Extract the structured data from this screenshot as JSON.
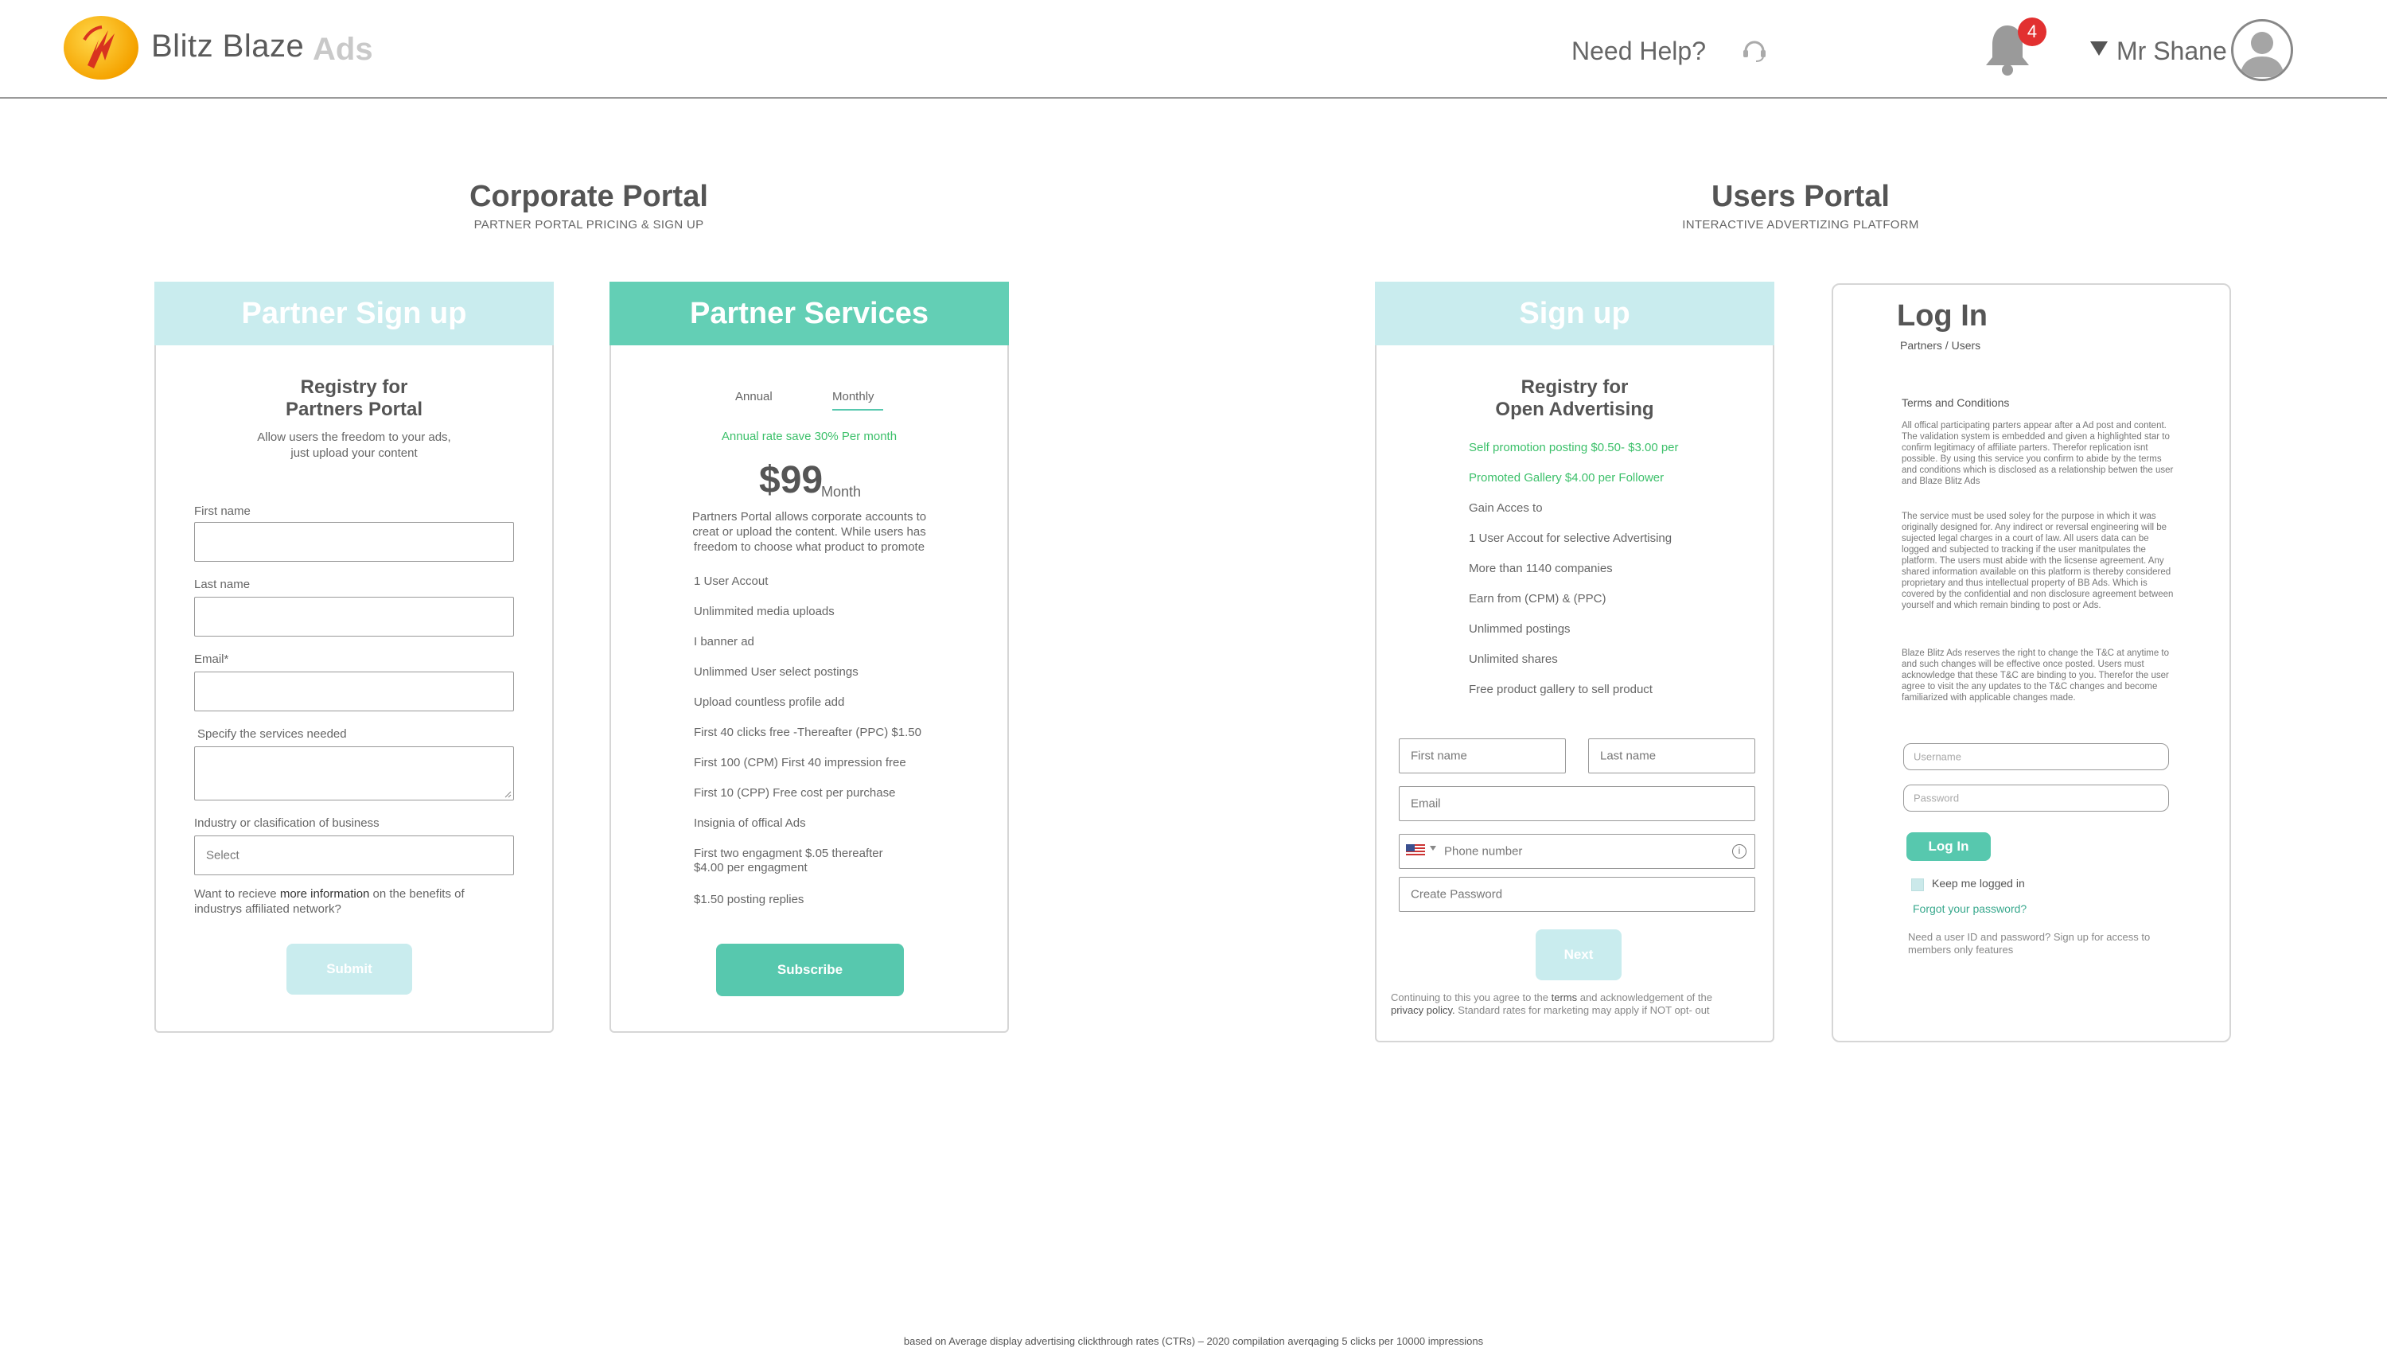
{
  "header": {
    "brand": "Blitz Blaze",
    "brand_sub": "Ads",
    "help": "Need Help?",
    "notifications": "4",
    "user": "Mr Shane"
  },
  "corporate": {
    "title": "Corporate  Portal",
    "subtitle": "PARTNER PORTAL   PRICING & SIGN UP"
  },
  "users_portal": {
    "title": "Users Portal",
    "subtitle": "INTERACTIVE ADVERTIZING PLATFORM"
  },
  "partner_signup": {
    "header": "Partner Sign up",
    "title_line1": "Registry for",
    "title_line2": "Partners Portal",
    "desc_line1": "Allow users the freedom to your ads,",
    "desc_line2": "just upload your content",
    "first_name_label": "First name",
    "last_name_label": "Last name",
    "email_label": "Email*",
    "services_label": "Specify the services needed",
    "industry_label": "Industry or clasification of business",
    "industry_placeholder": "Select",
    "info_pre": "Want to recieve ",
    "info_link": "more information",
    "info_post": " on the benefits of",
    "info_line2": "industrys affiliated network?",
    "submit": "Submit"
  },
  "partner_services": {
    "header": "Partner Services",
    "tab_annual": "Annual",
    "tab_monthly": "Monthly",
    "annual_save": "Annual rate save  30% Per month",
    "price": "$99",
    "price_unit": "Month",
    "desc_line1": "Partners Portal allows corporate accounts to",
    "desc_line2": "creat or upload the content. While users has",
    "desc_line3": "freedom to choose what product to promote",
    "features": [
      "1 User Accout",
      "Unlimmited media uploads",
      "I banner ad",
      "Unlimmed User  select postings",
      "Upload countless profile add",
      "First 40 clicks free -Thereafter (PPC) $1.50",
      "First 100 (CPM) First 40 impression free",
      "First 10 (CPP) Free cost per purchase",
      "Insignia of offical Ads",
      "First two engagment $.05 thereafter",
      "$4.00 per engagment",
      "$1.50 posting replies"
    ],
    "subscribe": "Subscribe"
  },
  "user_signup": {
    "header": "Sign up",
    "title_line1": "Registry for",
    "title_line2": "Open Advertising",
    "features": [
      "Self promotion posting $0.50- $3.00 per",
      "Promoted Gallery $4.00 per Follower",
      "Gain Acces to",
      "1 User Accout for  selective Advertising",
      "More than 1140 companies",
      "Earn from (CPM) & (PPC)",
      "Unlimmed  postings",
      "Unlimited shares",
      "Free product gallery to sell  product"
    ],
    "first_name": "First name",
    "last_name": "Last name",
    "email": "Email",
    "phone": "Phone number",
    "password": "Create Password",
    "next": "Next",
    "fine_line1_pre": "Continuing to this you agree to the ",
    "fine_terms": "terms",
    "fine_line1_post": " and acknowledgement of the",
    "fine_privacy": "privacy policy.",
    "fine_line2": " Standard rates for marketing may apply if NOT opt- out"
  },
  "login": {
    "title": "Log In",
    "subtitle": "Partners / Users",
    "terms_heading": "Terms and Conditions",
    "terms_p1": "All offical participating parters appear after a Ad post and content. The validation system is embedded and given a highlighted star to confirm legitimacy of affiliate parters. Therefor replication isnt possible. By using this service you confirm to abide by the terms and conditions which is disclosed as a relationship betwen the user and Blaze Blitz Ads",
    "terms_p2": "The service must be used soley for the purpose in which it was originally designed for. Any indirect or reversal engineering will be sujected legal charges in a court of law. All users data can be logged and subjected to tracking if the user manitpulates the platform. The users must abide with the licsense agreement. Any shared information available on this platform is thereby considered proprietary and thus intellectual property of BB Ads. Which is covered by the confidential and non disclosure agreement between yourself and which remain binding to post or Ads.",
    "terms_p3": "Blaze Blitz Ads reserves the right to change the T&C at anytime to and such changes will be effective once posted. Users must acknowledge that these T&C are binding to you. Therefor the user agree to visit the any updates to the T&C changes and become familiarized with applicable changes made.",
    "username_placeholder": "Username",
    "password_placeholder": "Password",
    "login_button": "Log In",
    "keep_logged": "Keep me logged in",
    "forgot": "Forgot your password?",
    "signup_note_line1": "Need a user ID and password? Sign up for access to",
    "signup_note_line2": "members only features"
  },
  "footer_note": "based on Average display advertising clickthrough rates (CTRs) – 2020 compilation averqaging  5 clicks per 10000 impressions",
  "colors": {
    "teal": "#63cfb5",
    "light_teal": "#c9ecee",
    "green_text": "#3cc06a",
    "badge_red": "#e23030"
  },
  "icons": [
    "flame-logo-icon",
    "headset-icon",
    "bell-icon",
    "avatar-icon",
    "us-flag-icon",
    "info-icon",
    "caret-down-icon"
  ]
}
